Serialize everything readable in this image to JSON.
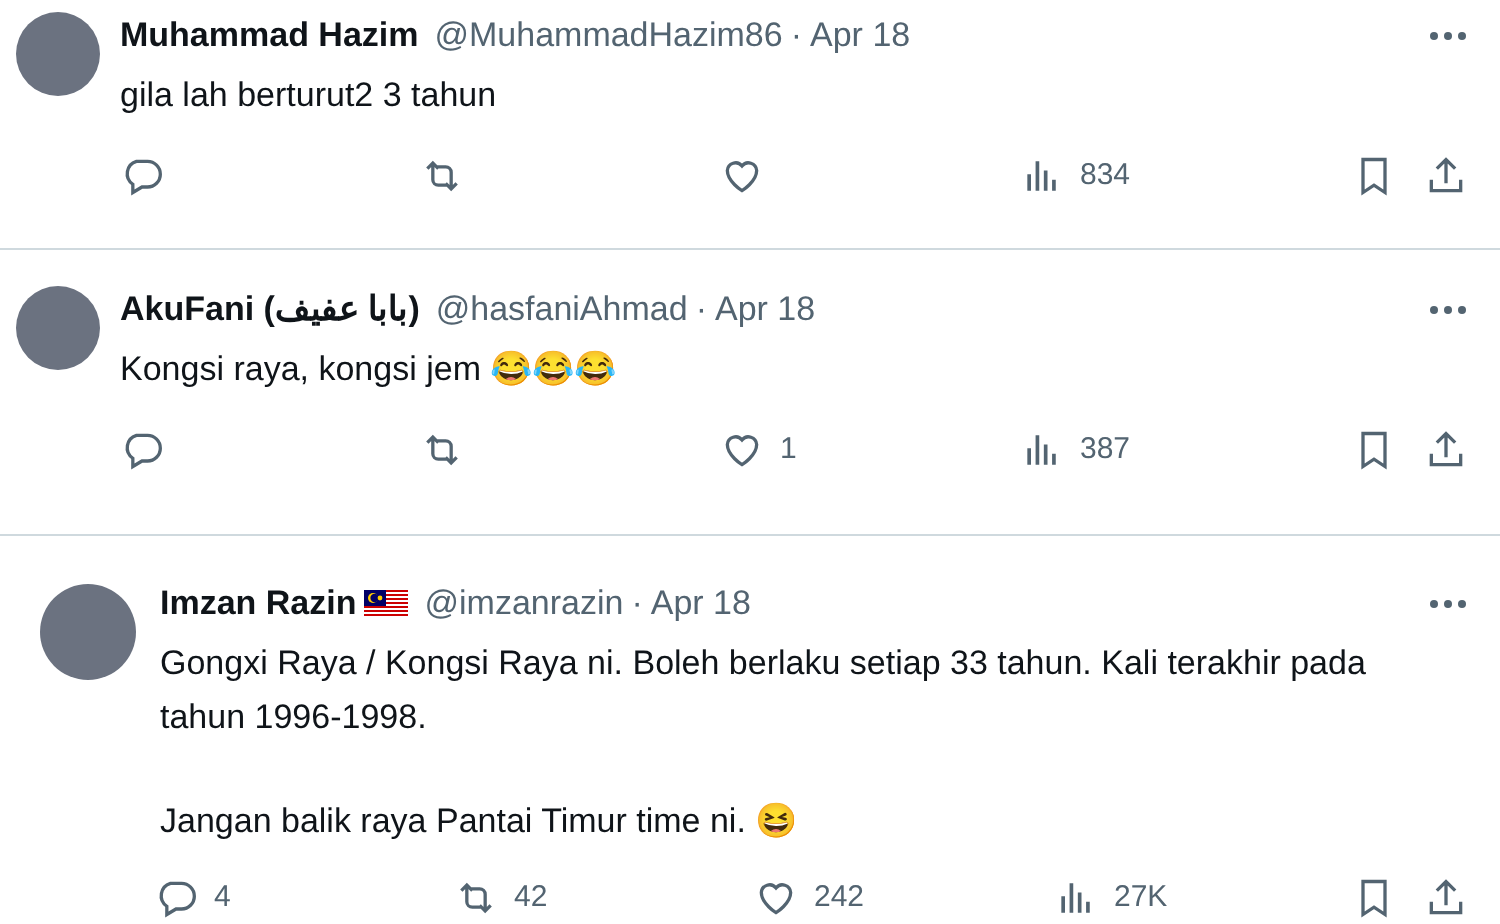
{
  "replies": [
    {
      "kind": "compact",
      "name": "Muhammad Hazim",
      "flag": false,
      "handle": "@MuhammadHazim86",
      "dot": "·",
      "date": "Apr 18",
      "paragraphs": [
        "gila lah berturut2 3 tahun"
      ],
      "stats": {
        "views": "834"
      }
    },
    {
      "kind": "compact",
      "name": "AkuFani (بابا عفيف)",
      "flag": false,
      "handle": "@hasfaniAhmad",
      "dot": "·",
      "date": "Apr 18",
      "paragraphs": [
        "Kongsi raya, kongsi jem 😂😂😂"
      ],
      "stats": {
        "likes": "1",
        "views": "387"
      }
    },
    {
      "kind": "wide",
      "name": "Imzan Razin",
      "flag": true,
      "handle": "@imzanrazin",
      "dot": "·",
      "date": "Apr 18",
      "paragraphs": [
        "Gongxi Raya / Kongsi Raya ni. Boleh berlaku setiap 33 tahun. Kali terakhir pada tahun 1996-1998.",
        "Jangan balik raya Pantai Timur time ni. 😆"
      ],
      "stats": {
        "replies": "4",
        "retweets": "42",
        "likes": "242",
        "views": "27K"
      }
    }
  ]
}
